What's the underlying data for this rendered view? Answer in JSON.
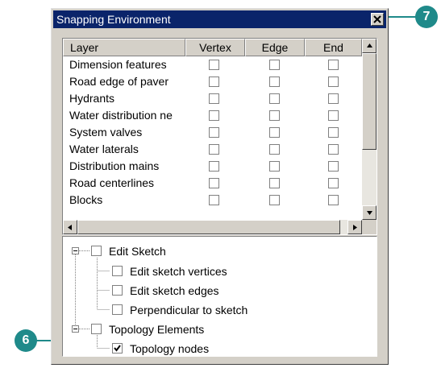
{
  "window": {
    "title": "Snapping Environment"
  },
  "table": {
    "columns": [
      "Layer",
      "Vertex",
      "Edge",
      "End"
    ],
    "rows": [
      {
        "name": "Dimension features",
        "vertex": false,
        "edge": false,
        "end": false
      },
      {
        "name": "Road  edge of paver",
        "vertex": false,
        "edge": false,
        "end": false
      },
      {
        "name": "Hydrants",
        "vertex": false,
        "edge": false,
        "end": false
      },
      {
        "name": "Water distribution ne",
        "vertex": false,
        "edge": false,
        "end": false
      },
      {
        "name": "System valves",
        "vertex": false,
        "edge": false,
        "end": false
      },
      {
        "name": "Water laterals",
        "vertex": false,
        "edge": false,
        "end": false
      },
      {
        "name": "Distribution mains",
        "vertex": false,
        "edge": false,
        "end": false
      },
      {
        "name": "Road centerlines",
        "vertex": false,
        "edge": false,
        "end": false
      },
      {
        "name": "Blocks",
        "vertex": false,
        "edge": false,
        "end": false
      }
    ]
  },
  "tree": {
    "edit_sketch": {
      "label": "Edit Sketch",
      "checked": false,
      "children": [
        {
          "label": "Edit sketch vertices",
          "checked": false
        },
        {
          "label": "Edit sketch edges",
          "checked": false
        },
        {
          "label": "Perpendicular to sketch",
          "checked": false
        }
      ]
    },
    "topology": {
      "label": "Topology Elements",
      "checked": false,
      "children": [
        {
          "label": "Topology nodes",
          "checked": true
        }
      ]
    }
  },
  "callouts": {
    "close": "7",
    "topology_nodes": "6"
  },
  "colors": {
    "titlebar": "#0a246a",
    "callout": "#1f8a8a",
    "dialog": "#d4d0c8"
  }
}
